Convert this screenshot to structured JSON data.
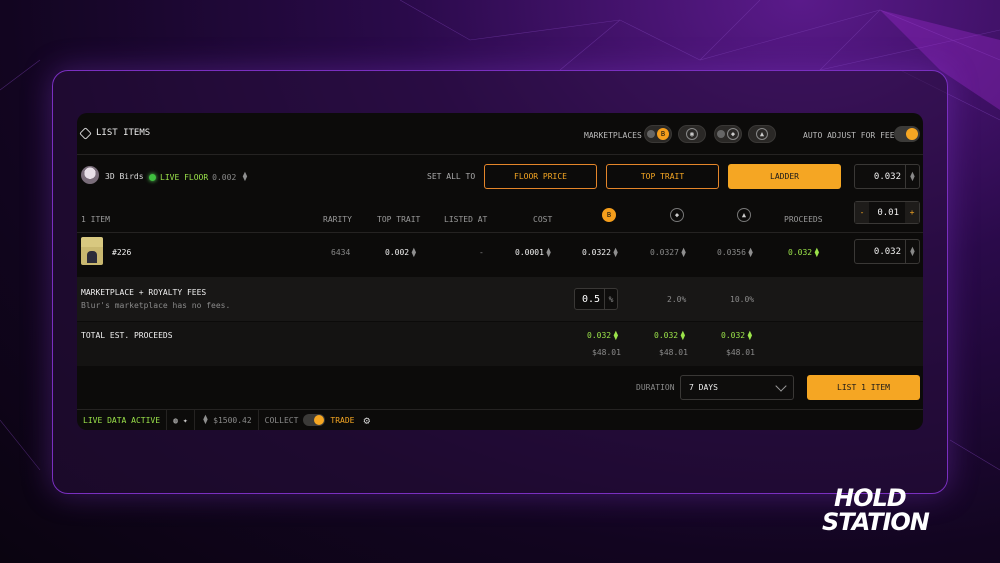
{
  "header": {
    "title": "LIST ITEMS",
    "marketplaces_label": "MARKETPLACES",
    "auto_adjust_label": "AUTO ADJUST FOR FEES"
  },
  "collection": {
    "name": "3D Birds",
    "live_floor_label": "LIVE FLOOR",
    "live_floor_value": "0.002",
    "set_all_label": "SET ALL TO",
    "buttons": {
      "floor_price": "FLOOR PRICE",
      "top_trait": "TOP TRAIT",
      "ladder": "LADDER"
    },
    "set_all_value": "0.032"
  },
  "table": {
    "headers": {
      "items": "1 ITEM",
      "rarity": "RARITY",
      "top_trait": "TOP TRAIT",
      "listed_at": "LISTED AT",
      "cost": "COST",
      "proceeds": "PROCEEDS"
    },
    "step_value": "0.01",
    "step_minus": "-",
    "step_plus": "+",
    "rows": [
      {
        "name": "#226",
        "rarity": "6434",
        "top_trait": "0.002",
        "listed_at": "-",
        "cost": "0.0001",
        "mp1": "0.0322",
        "mp2": "0.0327",
        "mp3": "0.0356",
        "proceeds": "0.032",
        "price": "0.032"
      }
    ]
  },
  "fees": {
    "label": "MARKETPLACE + ROYALTY FEES",
    "note": "Blur's marketplace has no fees.",
    "royalty_input": "0.5",
    "percent_symbol": "%",
    "mp2": "2.0%",
    "mp3": "10.0%"
  },
  "totals": {
    "label": "TOTAL EST. PROCEEDS",
    "values": [
      "0.032",
      "0.032",
      "0.032"
    ],
    "usd": [
      "$48.01",
      "$48.01",
      "$48.01"
    ]
  },
  "listing": {
    "duration_label": "DURATION",
    "duration_value": "7 DAYS",
    "submit": "LIST 1 ITEM"
  },
  "footer": {
    "live_data": "LIVE DATA ACTIVE",
    "eth_price": "$1500.42",
    "collect": "COLLECT",
    "trade": "TRADE"
  },
  "brand": {
    "line1": "HOLD",
    "line2": "STATION"
  },
  "colors": {
    "accent": "#f5a623",
    "green": "#9be34a",
    "frame": "#7a2fc0"
  }
}
